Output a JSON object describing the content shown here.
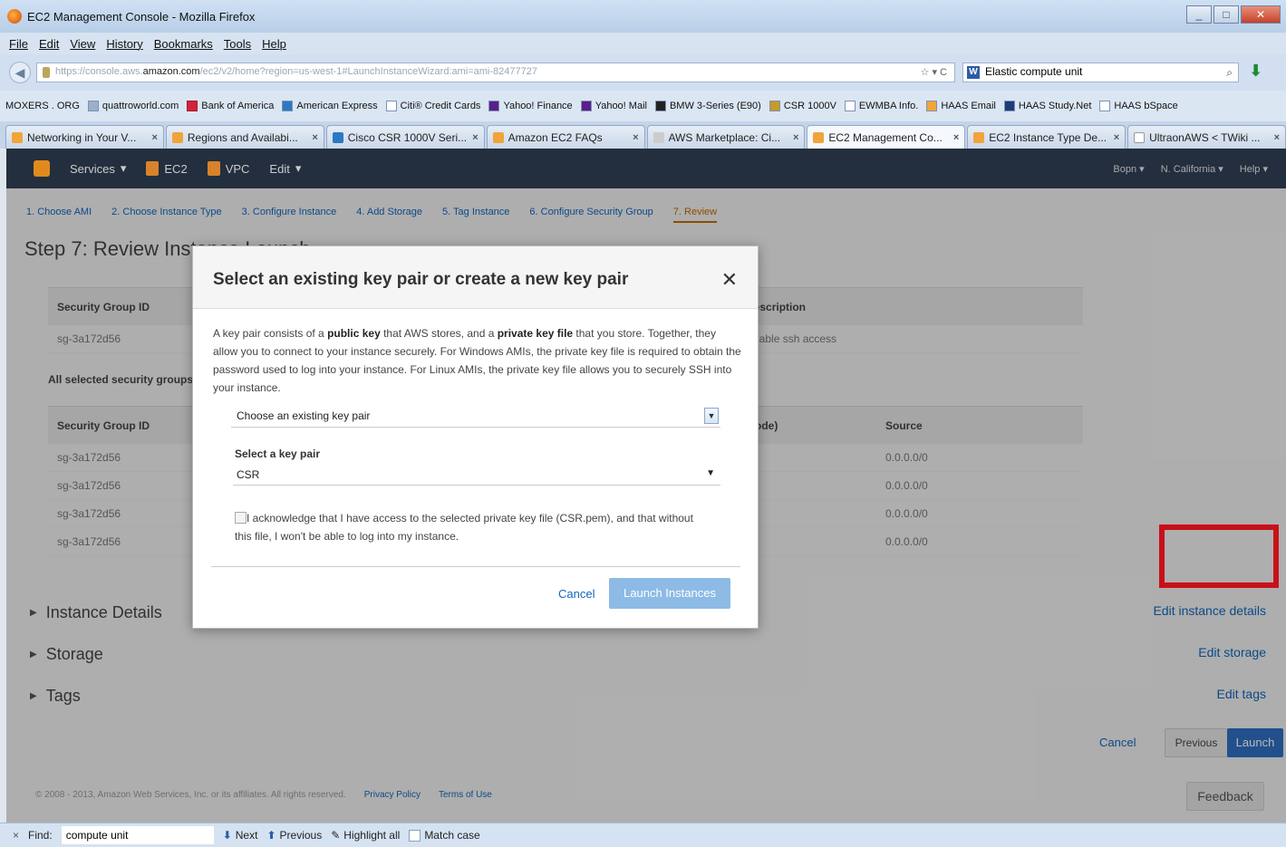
{
  "window": {
    "title": "EC2 Management Console - Mozilla Firefox"
  },
  "menu": [
    "File",
    "Edit",
    "View",
    "History",
    "Bookmarks",
    "Tools",
    "Help"
  ],
  "urlbar": {
    "url_prefix": "https://console.aws.",
    "url_domain": "amazon.com",
    "url_suffix": "/ec2/v2/home?region=us-west-1#LaunchInstanceWizard:ami=ami-82477727"
  },
  "search": {
    "engine": "W",
    "value": "Elastic compute unit"
  },
  "bookmarks": [
    "MOXERS . ORG",
    "quattroworld.com",
    "Bank of America",
    "American Express",
    "Citi® Credit Cards",
    "Yahoo! Finance",
    "Yahoo! Mail",
    "BMW 3-Series (E90)",
    "CSR 1000V",
    "EWMBA Info.",
    "HAAS Email",
    "HAAS Study.Net",
    "HAAS bSpace"
  ],
  "tabs": [
    "Networking in Your V...",
    "Regions and Availabi...",
    "Cisco CSR 1000V Seri...",
    "Amazon EC2 FAQs",
    "AWS Marketplace: Ci...",
    "EC2 Management Co...",
    "EC2 Instance Type De...",
    "UltraonAWS < TWiki ..."
  ],
  "active_tab_index": 5,
  "aws_nav": {
    "services": "Services",
    "ec2": "EC2",
    "vpc": "VPC",
    "edit": "Edit",
    "user": "Bopn",
    "region": "N. California",
    "help": "Help"
  },
  "wizard_steps": [
    "1. Choose AMI",
    "2. Choose Instance Type",
    "3. Configure Instance",
    "4. Add Storage",
    "5. Tag Instance",
    "6. Configure Security Group",
    "7. Review"
  ],
  "page": {
    "step_title": "Step 7: Review Instance Launch"
  },
  "sg_table1": {
    "headers": {
      "id": "Security Group ID",
      "desc": "Description"
    },
    "row": {
      "id": "sg-3a172d56",
      "desc": "Enable ssh access"
    }
  },
  "all_selected_label": "All selected security groups inbound rules",
  "sg_table2": {
    "headers": {
      "id": "Security Group ID",
      "port": "Port Range (Code)",
      "source": "Source"
    },
    "rows": [
      {
        "id": "sg-3a172d56",
        "source": "0.0.0.0/0"
      },
      {
        "id": "sg-3a172d56",
        "source": "0.0.0.0/0"
      },
      {
        "id": "sg-3a172d56",
        "source": "0.0.0.0/0"
      },
      {
        "id": "sg-3a172d56",
        "source": "0.0.0.0/0"
      }
    ]
  },
  "sections": [
    {
      "label": "Instance Details",
      "edit": "Edit instance details"
    },
    {
      "label": "Storage",
      "edit": "Edit storage"
    },
    {
      "label": "Tags",
      "edit": "Edit tags"
    }
  ],
  "footer": {
    "cancel": "Cancel",
    "previous": "Previous",
    "launch": "Launch",
    "feedback": "Feedback",
    "copyright": "© 2008 - 2013, Amazon Web Services, Inc. or its affiliates. All rights reserved.",
    "privacy": "Privacy Policy",
    "terms": "Terms of Use"
  },
  "modal": {
    "title": "Select an existing key pair or create a new key pair",
    "desc_1": "A key pair consists of a ",
    "desc_b1": "public key",
    "desc_2": " that AWS stores, and a ",
    "desc_b2": "private key file",
    "desc_3": " that you store. Together, they allow you to connect to your instance securely. For Windows AMIs, the private key file is required to obtain the password used to log into your instance. For Linux AMIs, the private key file allows you to securely SSH into your instance.",
    "select_mode": "Choose an existing key pair",
    "keypair_label": "Select a key pair",
    "keypair_value": "CSR",
    "ack": "I acknowledge that I have access to the selected private key file (CSR.pem), and that without this file, I won't be able to log into my instance.",
    "cancel": "Cancel",
    "launch": "Launch Instances"
  },
  "findbar": {
    "label": "Find:",
    "value": "compute unit",
    "next": "Next",
    "previous": "Previous",
    "highlight": "Highlight all",
    "match_case": "Match case"
  }
}
